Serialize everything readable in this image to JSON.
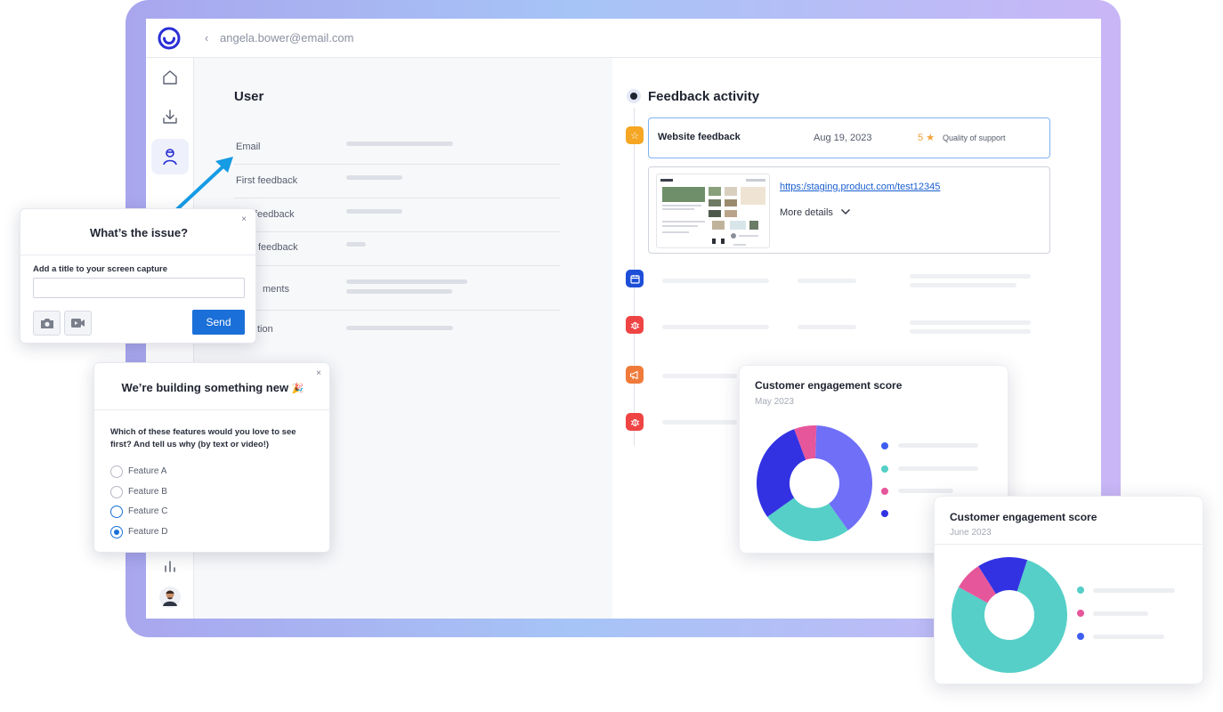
{
  "header": {
    "back_icon": "chevron-left-icon",
    "email": "angela.bower@email.com"
  },
  "sidebar": {
    "items": [
      "home-icon",
      "download-icon",
      "user-icon",
      "bar-chart-icon",
      "avatar"
    ]
  },
  "user_panel": {
    "title": "User",
    "fields": [
      {
        "label": "Email"
      },
      {
        "label": "First feedback"
      },
      {
        "label": "feedback"
      },
      {
        "label": "feedback"
      },
      {
        "label": "ments"
      },
      {
        "label": "tion"
      }
    ]
  },
  "activity": {
    "title": "Feedback activity",
    "feedback_card": {
      "title": "Website feedback",
      "date": "Aug 19, 2023",
      "rating": "5",
      "star": "★",
      "category": "Quality of support"
    },
    "detail_card": {
      "link": "https:/staging.product.com/test12345",
      "more": "More details"
    },
    "timeline_icons": [
      "star-icon",
      "calendar-icon",
      "bug-icon",
      "megaphone-icon",
      "bug-icon"
    ],
    "colors": {
      "star": "#f5a623",
      "calendar": "#1d4ed8",
      "bug": "#ef4444",
      "megaphone": "#f07a3a"
    }
  },
  "issue_popup": {
    "title": "What’s the issue?",
    "close": "×",
    "field_label": "Add a title to your screen capture",
    "input_value": "",
    "send_label": "Send",
    "camera_icon": "camera-icon",
    "video_icon": "video-icon"
  },
  "survey_popup": {
    "title": "We’re building something new",
    "emoji": "🎉",
    "close": "×",
    "question": "Which of these features would you love to see first? And tell us why (by text or video!)",
    "options": [
      {
        "label": "Feature A",
        "state": "unselected"
      },
      {
        "label": "Feature B",
        "state": "unselected"
      },
      {
        "label": "Feature C",
        "state": "hover"
      },
      {
        "label": "Feature D",
        "state": "selected"
      }
    ]
  },
  "chart_may": {
    "title": "Customer engagement score",
    "subtitle": "May 2023"
  },
  "chart_june": {
    "title": "Customer engagement score",
    "subtitle": "June 2023"
  },
  "chart_data": [
    {
      "type": "pie",
      "title": "Customer engagement score",
      "subtitle": "May 2023",
      "values": [
        38,
        24,
        28,
        6
      ],
      "colors": [
        "#6f6ff8",
        "#55cfc7",
        "#3232e3",
        "#e6569b"
      ]
    },
    {
      "type": "pie",
      "title": "Customer engagement score",
      "subtitle": "June 2023",
      "values": [
        78,
        8,
        14
      ],
      "colors": [
        "#55cfc7",
        "#e6569b",
        "#3232e3"
      ]
    }
  ]
}
